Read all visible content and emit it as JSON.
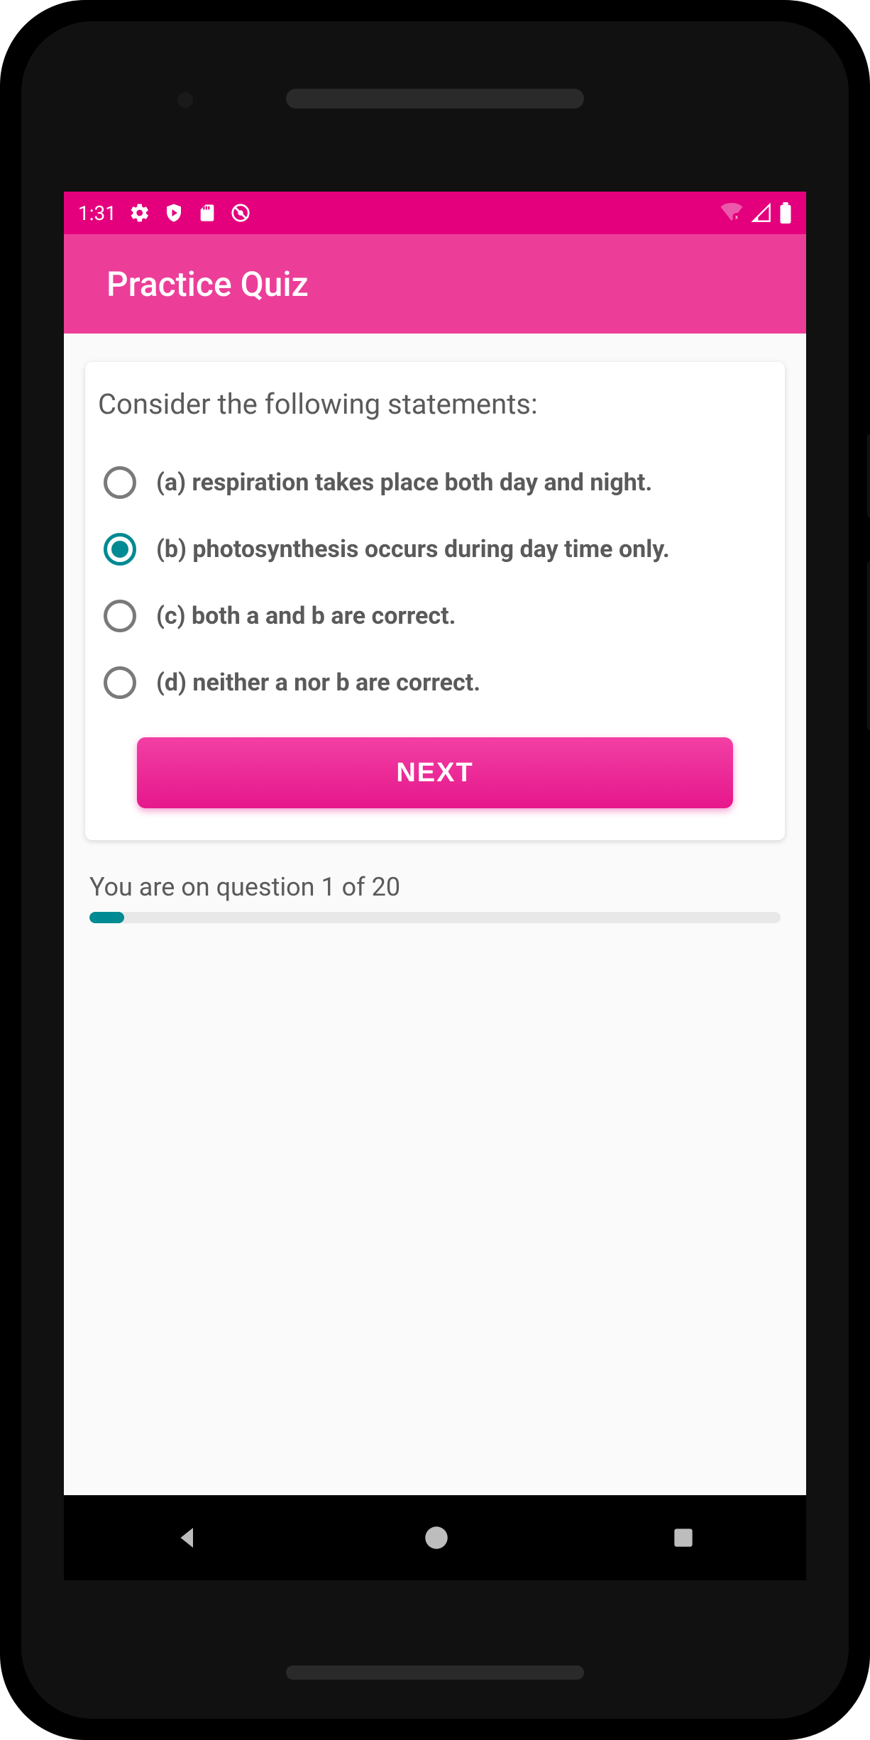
{
  "status": {
    "time": "1:31"
  },
  "appbar": {
    "title": "Practice Quiz"
  },
  "quiz": {
    "question": "Consider the following statements:",
    "options": [
      {
        "label": "(a) respiration takes place both day and night.",
        "selected": false
      },
      {
        "label": "(b) photosynthesis occurs during day time only.",
        "selected": true
      },
      {
        "label": "(c) both a and b are correct.",
        "selected": false
      },
      {
        "label": "(d) neither a nor b are correct.",
        "selected": false
      }
    ],
    "next_label": "NEXT"
  },
  "progress": {
    "text": "You are on question 1 of 20",
    "current": 1,
    "total": 20,
    "percent": 5
  },
  "colors": {
    "status_bar": "#e4007d",
    "app_bar": "#ec3e98",
    "accent_button": "#e6178c",
    "radio_selected": "#008a93",
    "progress_fill": "#008a93"
  }
}
